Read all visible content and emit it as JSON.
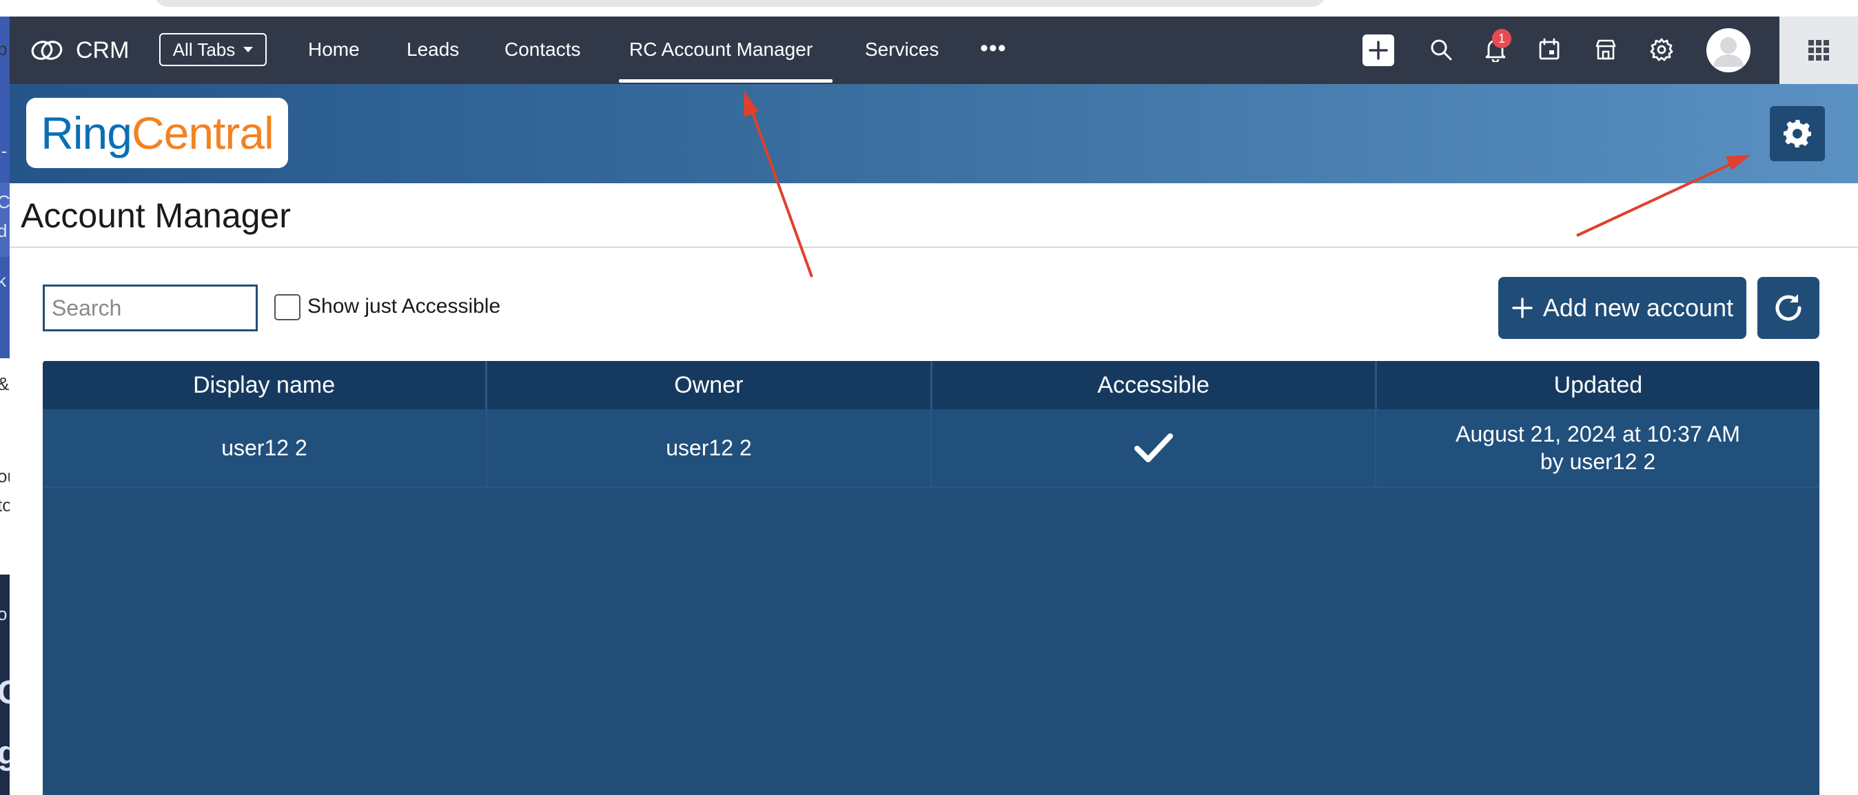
{
  "app": {
    "name": "CRM",
    "all_tabs_label": "All Tabs",
    "notification_count": "1"
  },
  "nav": {
    "tabs": [
      {
        "label": "Home",
        "active": false
      },
      {
        "label": "Leads",
        "active": false
      },
      {
        "label": "Contacts",
        "active": false
      },
      {
        "label": "RC Account Manager",
        "active": true
      },
      {
        "label": "Services",
        "active": false
      }
    ],
    "more_label": "•••"
  },
  "banner": {
    "logo_part1": "Ring",
    "logo_part2": "Central"
  },
  "page": {
    "title": "Account Manager"
  },
  "toolbar": {
    "search_placeholder": "Search",
    "search_value": "",
    "show_accessible_label": "Show just Accessible",
    "show_accessible_checked": false,
    "add_account_label": "Add new account"
  },
  "table": {
    "headers": [
      "Display name",
      "Owner",
      "Accessible",
      "Updated"
    ],
    "rows": [
      {
        "display_name": "user12 2",
        "owner": "user12 2",
        "accessible": true,
        "updated_line1": "August 21, 2024 at 10:37 AM",
        "updated_line2": "by user12 2"
      }
    ]
  },
  "left_window_fragments": [
    "p",
    "j-",
    "Ce",
    "d",
    "k",
    "&",
    "ou",
    "to",
    "o",
    "C",
    "g"
  ],
  "colors": {
    "navbar": "#313949",
    "accent": "#1f4d78",
    "table_header": "#163a5f",
    "table_body": "#234e78",
    "notification_badge": "#e84b55",
    "annotation_arrow": "#e0402c",
    "logo_blue": "#0a6fb4",
    "logo_orange": "#f38221"
  }
}
